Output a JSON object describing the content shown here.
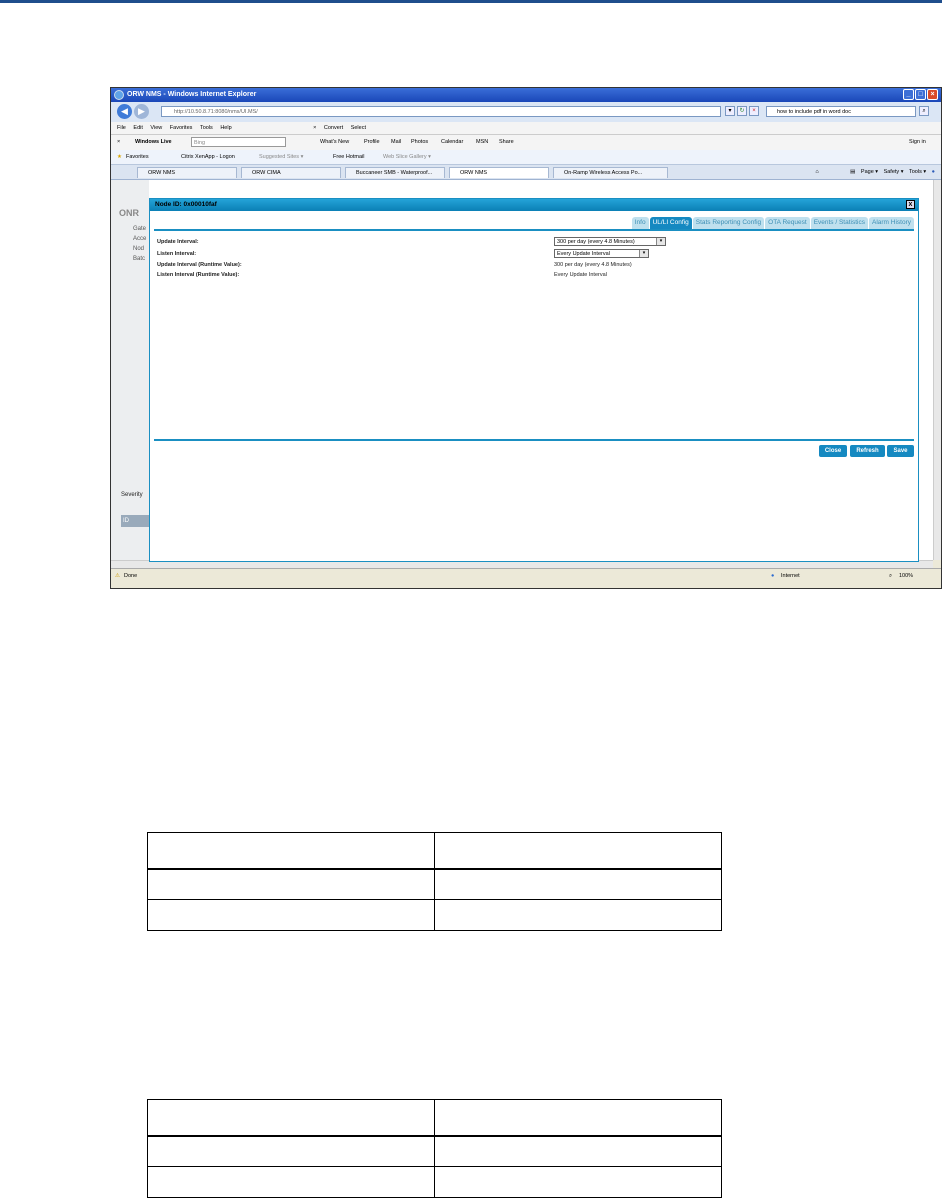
{
  "browser": {
    "title": "ORW NMS - Windows Internet Explorer",
    "url": "http://10.50.8.71:8080/nms/UI.MS/",
    "search_text": "how to include pdf in word doc",
    "menu": [
      "File",
      "Edit",
      "View",
      "Favorites",
      "Tools",
      "Help"
    ],
    "convert_label": "Convert",
    "select_label": "Select",
    "live_label": "Windows Live",
    "bing_placeholder": "Bing",
    "live_links": [
      "What's New",
      "Profile",
      "Mail",
      "Photos",
      "Calendar",
      "MSN",
      "Share"
    ],
    "sign_in": "Sign in",
    "favorites_label": "Favorites",
    "fav_links": [
      "Citrix XenApp - Logon",
      "Suggested Sites ▾",
      "Free Hotmail",
      "Web Slice Gallery ▾"
    ],
    "tabs": [
      "ORW NMS",
      "ORW CIMA",
      "Buccaneer SMB - Waterproof...",
      "ORW NMS",
      "On-Ramp Wireless Access Po..."
    ],
    "commands": [
      "Page ▾",
      "Safety ▾",
      "Tools ▾"
    ],
    "status_done": "Done",
    "status_zone": "Internet",
    "zoom": "100%"
  },
  "background_page": {
    "logo": "ONR",
    "nav": [
      "Gate",
      "Acce",
      "Nod",
      "Batc"
    ],
    "severity": "Severity",
    "id": "ID"
  },
  "modal": {
    "title": "Node ID: 0x00010faf",
    "close_x": "x",
    "tabs": [
      "Info",
      "UL/LI Config",
      "Stats Reporting Config",
      "OTA Request",
      "Events / Statistics",
      "Alarm History"
    ],
    "active_tab": "UL/LI Config",
    "fields": [
      {
        "label": "Update Interval:",
        "value": "300 per day (every 4.8 Minutes)"
      },
      {
        "label": "Listen Interval:",
        "value": "Every Update Interval"
      },
      {
        "label": "Update Interval (Runtime Value):",
        "value": "300 per day (every 4.8 Minutes)"
      },
      {
        "label": "Listen Interval (Runtime Value):",
        "value": "Every Update Interval"
      }
    ],
    "buttons": {
      "close": "Close",
      "refresh": "Refresh",
      "save": "Save"
    }
  },
  "colors": {
    "accent": "#1589c1",
    "titlebar": "#1a47b8"
  }
}
